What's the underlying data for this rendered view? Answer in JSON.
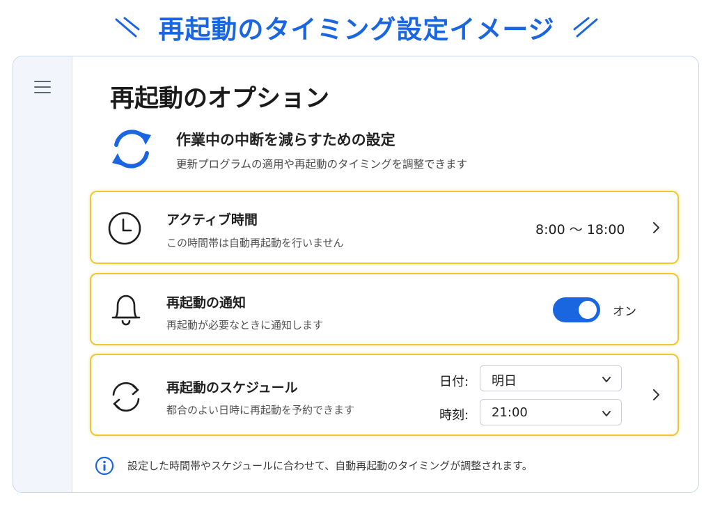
{
  "headline": "再起動のタイミング設定イメージ",
  "page": {
    "title": "再起動のオプション"
  },
  "intro": {
    "title": "作業中の中断を減らすための設定",
    "description": "更新プログラムの適用や再起動のタイミングを調整できます",
    "icon": "refresh-icon"
  },
  "active_hours": {
    "title": "アクティブ時間",
    "description": "この時間帯は自動再起動を行いません",
    "value": "8:00 ～ 18:00",
    "icon": "clock-icon"
  },
  "restart_notification": {
    "title": "再起動の通知",
    "description": "再起動が必要なときに通知します",
    "toggle_state": "オン",
    "enabled": true,
    "icon": "bell-icon"
  },
  "restart_schedule": {
    "title": "再起動のスケジュール",
    "description": "都合のよい日時に再起動を予約できます",
    "date_label": "日付:",
    "date_value": "明日",
    "time_label": "時刻:",
    "time_value": "21:00",
    "icon": "sync-icon"
  },
  "info_note": "設定した時間帯やスケジュールに合わせて、自動再起動のタイミングが調整されます。",
  "colors": {
    "accent": "#1a66e0",
    "card_border": "#f2c630",
    "rail_bg": "#f2f5fb"
  }
}
